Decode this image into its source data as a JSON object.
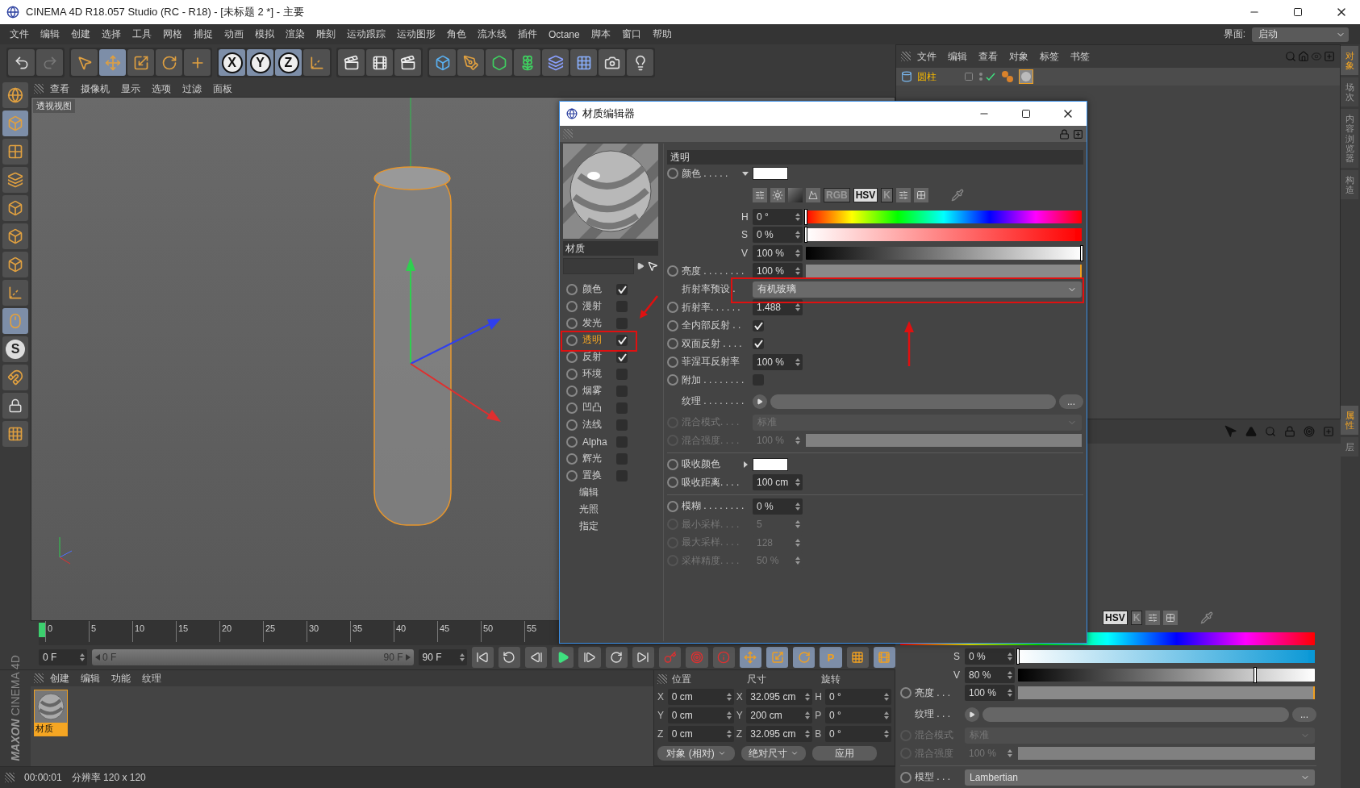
{
  "app": {
    "title": "CINEMA 4D R18.057 Studio (RC - R18) - [未标题 2 *] - 主要",
    "layout_label": "界面:",
    "layout_value": "启动"
  },
  "menu": [
    "文件",
    "编辑",
    "创建",
    "选择",
    "工具",
    "网格",
    "捕捉",
    "动画",
    "模拟",
    "渲染",
    "雕刻",
    "运动跟踪",
    "运动图形",
    "角色",
    "流水线",
    "插件",
    "Octane",
    "脚本",
    "窗口",
    "帮助"
  ],
  "toolbar": {
    "axis_buttons": [
      "X",
      "Y",
      "Z"
    ]
  },
  "left_tools": {
    "letter_button": "S"
  },
  "viewport": {
    "menu": [
      "查看",
      "摄像机",
      "显示",
      "选项",
      "过滤",
      "面板"
    ],
    "label": "透视视图"
  },
  "timeline": {
    "ticks": [
      "0",
      "5",
      "10",
      "15",
      "20",
      "25",
      "30",
      "35",
      "40",
      "45",
      "50",
      "55"
    ],
    "start": "0 F",
    "range": {
      "start": "0 F",
      "end": "90 F",
      "level": 1
    },
    "end": "90 F",
    "letter_button": "P"
  },
  "material_manager": {
    "menu": [
      "创建",
      "编辑",
      "功能",
      "纹理"
    ],
    "materials": [
      {
        "name": "材质",
        "selected": true
      }
    ]
  },
  "logo": {
    "brand": "MAXON",
    "product": "CINEMA 4D"
  },
  "coordinates": {
    "headers": [
      "位置",
      "尺寸",
      "旋转"
    ],
    "rows": [
      {
        "axis_a": "X",
        "a": "0 cm",
        "axis_b": "X",
        "b": "32.095 cm",
        "axis_c": "H",
        "c": "0 °"
      },
      {
        "axis_a": "Y",
        "a": "0 cm",
        "axis_b": "Y",
        "b": "200 cm",
        "axis_c": "P",
        "c": "0 °"
      },
      {
        "axis_a": "Z",
        "a": "0 cm",
        "axis_b": "Z",
        "b": "32.095 cm",
        "axis_c": "B",
        "c": "0 °"
      }
    ],
    "buttons": [
      {
        "label": "对象 (相对)",
        "kind": "dropdown"
      },
      {
        "label": "绝对尺寸",
        "kind": "dropdown"
      },
      {
        "label": "应用",
        "kind": "button"
      }
    ]
  },
  "status_bar": {
    "time": "00:00:01",
    "message": "分辨率 120 x 120"
  },
  "object_manager": {
    "menu": [
      "文件",
      "编辑",
      "查看",
      "对象",
      "标签",
      "书签"
    ],
    "objects": [
      {
        "name": "圆柱",
        "selected": true
      }
    ]
  },
  "side_tabs": [
    {
      "label": "对象",
      "selected": true
    },
    {
      "label": "场次",
      "selected": false
    },
    {
      "label": "内容浏览器",
      "selected": false
    },
    {
      "label": "构造",
      "selected": false
    }
  ],
  "attribute_tabs": [
    {
      "label": "属性",
      "selected": true
    },
    {
      "label": "层",
      "selected": false
    }
  ],
  "attributes": {
    "rows": [
      {
        "kind": "modes",
        "picker_icons": false,
        "modes": [
          {
            "label": "HSV",
            "selected": true
          },
          {
            "label": "K",
            "selected": false
          }
        ]
      },
      {
        "kind": "hue_bar"
      },
      {
        "kind": "saturation_slider",
        "label": "S",
        "value": "0 %",
        "color": "#0a98d6",
        "level": 0
      },
      {
        "kind": "value_slider",
        "label": "V",
        "value": "80 %",
        "level": 0.8
      },
      {
        "kind": "slider",
        "label": "亮度 . . .",
        "keyframe": true,
        "value": "100 %",
        "level": 1,
        "disabled": false
      },
      {
        "kind": "texture",
        "label": "纹理 . . .",
        "keyframe": false,
        "button": "..."
      },
      {
        "kind": "dropdown",
        "label": "混合模式",
        "keyframe": true,
        "value": "标准",
        "disabled": true
      },
      {
        "kind": "slider",
        "label": "混合强度",
        "keyframe": true,
        "value": "100 %",
        "level": 1,
        "disabled": true
      },
      {
        "kind": "separator"
      },
      {
        "kind": "dropdown",
        "label": "模型 . . .",
        "keyframe": true,
        "value": "Lambertian",
        "disabled": false
      }
    ]
  },
  "material_editor": {
    "title": "材质编辑器",
    "name": "材质",
    "channels": [
      {
        "label": "颜色",
        "kind": "channel",
        "checked": true,
        "selected": false
      },
      {
        "label": "漫射",
        "kind": "channel",
        "checked": false,
        "selected": false
      },
      {
        "label": "发光",
        "kind": "channel",
        "checked": false,
        "selected": false
      },
      {
        "label": "透明",
        "kind": "channel",
        "checked": true,
        "selected": true
      },
      {
        "label": "反射",
        "kind": "channel",
        "checked": true,
        "selected": false
      },
      {
        "label": "环境",
        "kind": "channel",
        "checked": false,
        "selected": false
      },
      {
        "label": "烟雾",
        "kind": "channel",
        "checked": false,
        "selected": false
      },
      {
        "label": "凹凸",
        "kind": "channel",
        "checked": false,
        "selected": false
      },
      {
        "label": "法线",
        "kind": "channel",
        "checked": false,
        "selected": false
      },
      {
        "label": "Alpha",
        "kind": "channel",
        "checked": false,
        "selected": false
      },
      {
        "label": "辉光",
        "kind": "channel",
        "checked": false,
        "selected": false
      },
      {
        "label": "置换",
        "kind": "channel",
        "checked": false,
        "selected": false
      },
      {
        "label": "编辑",
        "kind": "page",
        "selected": false
      },
      {
        "label": "光照",
        "kind": "page",
        "selected": false
      },
      {
        "label": "指定",
        "kind": "page",
        "selected": false
      }
    ],
    "section": "透明",
    "rows": [
      {
        "kind": "color",
        "label": "颜色 . . . . .",
        "keyframe": true,
        "color": "#ffffff",
        "expanded": true
      },
      {
        "kind": "modes",
        "picker_icons": true,
        "modes": [
          {
            "label": "RGB",
            "selected": false
          },
          {
            "label": "HSV",
            "selected": true
          },
          {
            "label": "K",
            "selected": false
          }
        ]
      },
      {
        "kind": "hue_slider",
        "label": "H",
        "value": "0 °",
        "level": 0
      },
      {
        "kind": "saturation_slider",
        "label": "S",
        "value": "0 %",
        "color": "#ff0000",
        "level": 0
      },
      {
        "kind": "value_slider",
        "label": "V",
        "value": "100 %",
        "level": 1
      },
      {
        "kind": "slider",
        "label": "亮度 . . . . . . . .",
        "keyframe": true,
        "value": "100 %",
        "level": 1,
        "disabled": false
      },
      {
        "kind": "dropdown",
        "label": "折射率预设 .",
        "keyframe": false,
        "value": "有机玻璃",
        "disabled": false
      },
      {
        "kind": "number",
        "label": "折射率. . . . . .",
        "keyframe": true,
        "value": "1.488",
        "disabled": false
      },
      {
        "kind": "checkbox",
        "label": "全内部反射 . .",
        "keyframe": true,
        "checked": true
      },
      {
        "kind": "checkbox",
        "label": "双面反射 . . . .",
        "keyframe": true,
        "checked": true
      },
      {
        "kind": "number",
        "label": "菲涅耳反射率",
        "keyframe": true,
        "value": "100 %",
        "disabled": false
      },
      {
        "kind": "checkbox",
        "label": "附加 . . . . . . . .",
        "keyframe": true,
        "checked": false
      },
      {
        "kind": "texture",
        "label": "纹理 . . . . . . . .",
        "keyframe": false,
        "button": "..."
      },
      {
        "kind": "dropdown",
        "label": "混合模式. . . .",
        "keyframe": true,
        "value": "标准",
        "disabled": true
      },
      {
        "kind": "slider",
        "label": "混合强度. . . .",
        "keyframe": true,
        "value": "100 %",
        "level": 1,
        "disabled": true
      },
      {
        "kind": "separator"
      },
      {
        "kind": "color",
        "label": "吸收颜色",
        "keyframe": true,
        "color": "#ffffff",
        "expanded": false
      },
      {
        "kind": "number",
        "label": "吸收距离. . . .",
        "keyframe": true,
        "value": "100 cm",
        "disabled": false
      },
      {
        "kind": "separator"
      },
      {
        "kind": "number",
        "label": "模糊 . . . . . . . .",
        "keyframe": true,
        "value": "0 %",
        "disabled": false
      },
      {
        "kind": "number",
        "label": "最小采样. . . .",
        "keyframe": true,
        "value": "5",
        "disabled": true
      },
      {
        "kind": "number",
        "label": "最大采样. . . .",
        "keyframe": true,
        "value": "128",
        "disabled": true
      },
      {
        "kind": "number",
        "label": "采样精度. . . .",
        "keyframe": true,
        "value": "50 %",
        "disabled": true
      }
    ]
  }
}
